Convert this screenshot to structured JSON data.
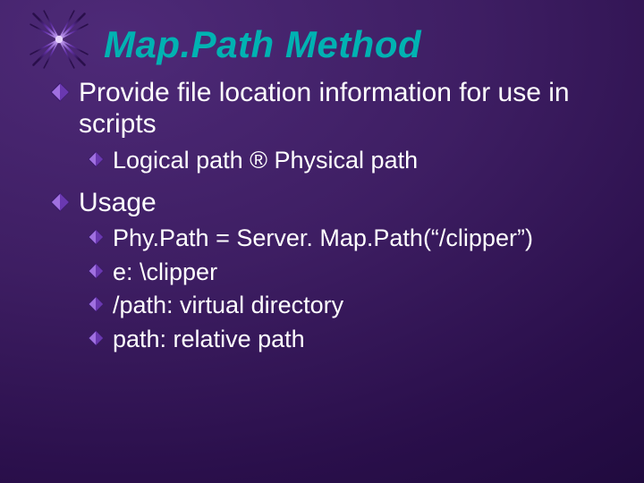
{
  "slide": {
    "title": "Map.Path Method",
    "items": [
      {
        "level": 1,
        "text": "Provide file location information for use in scripts"
      },
      {
        "level": 2,
        "text": "Logical path ® Physical path"
      },
      {
        "level": 1,
        "text": "Usage"
      },
      {
        "level": 2,
        "text": "Phy.Path = Server. Map.Path(“/clipper”)"
      },
      {
        "level": 2,
        "text": "e: \\clipper"
      },
      {
        "level": 2,
        "text": "/path: virtual directory"
      },
      {
        "level": 2,
        "text": "path: relative path"
      }
    ]
  },
  "colors": {
    "title": "#00b2b2",
    "bullet_fill": "#a070e0",
    "bullet_stroke": "#5a2aa0",
    "text": "#ffffff"
  }
}
